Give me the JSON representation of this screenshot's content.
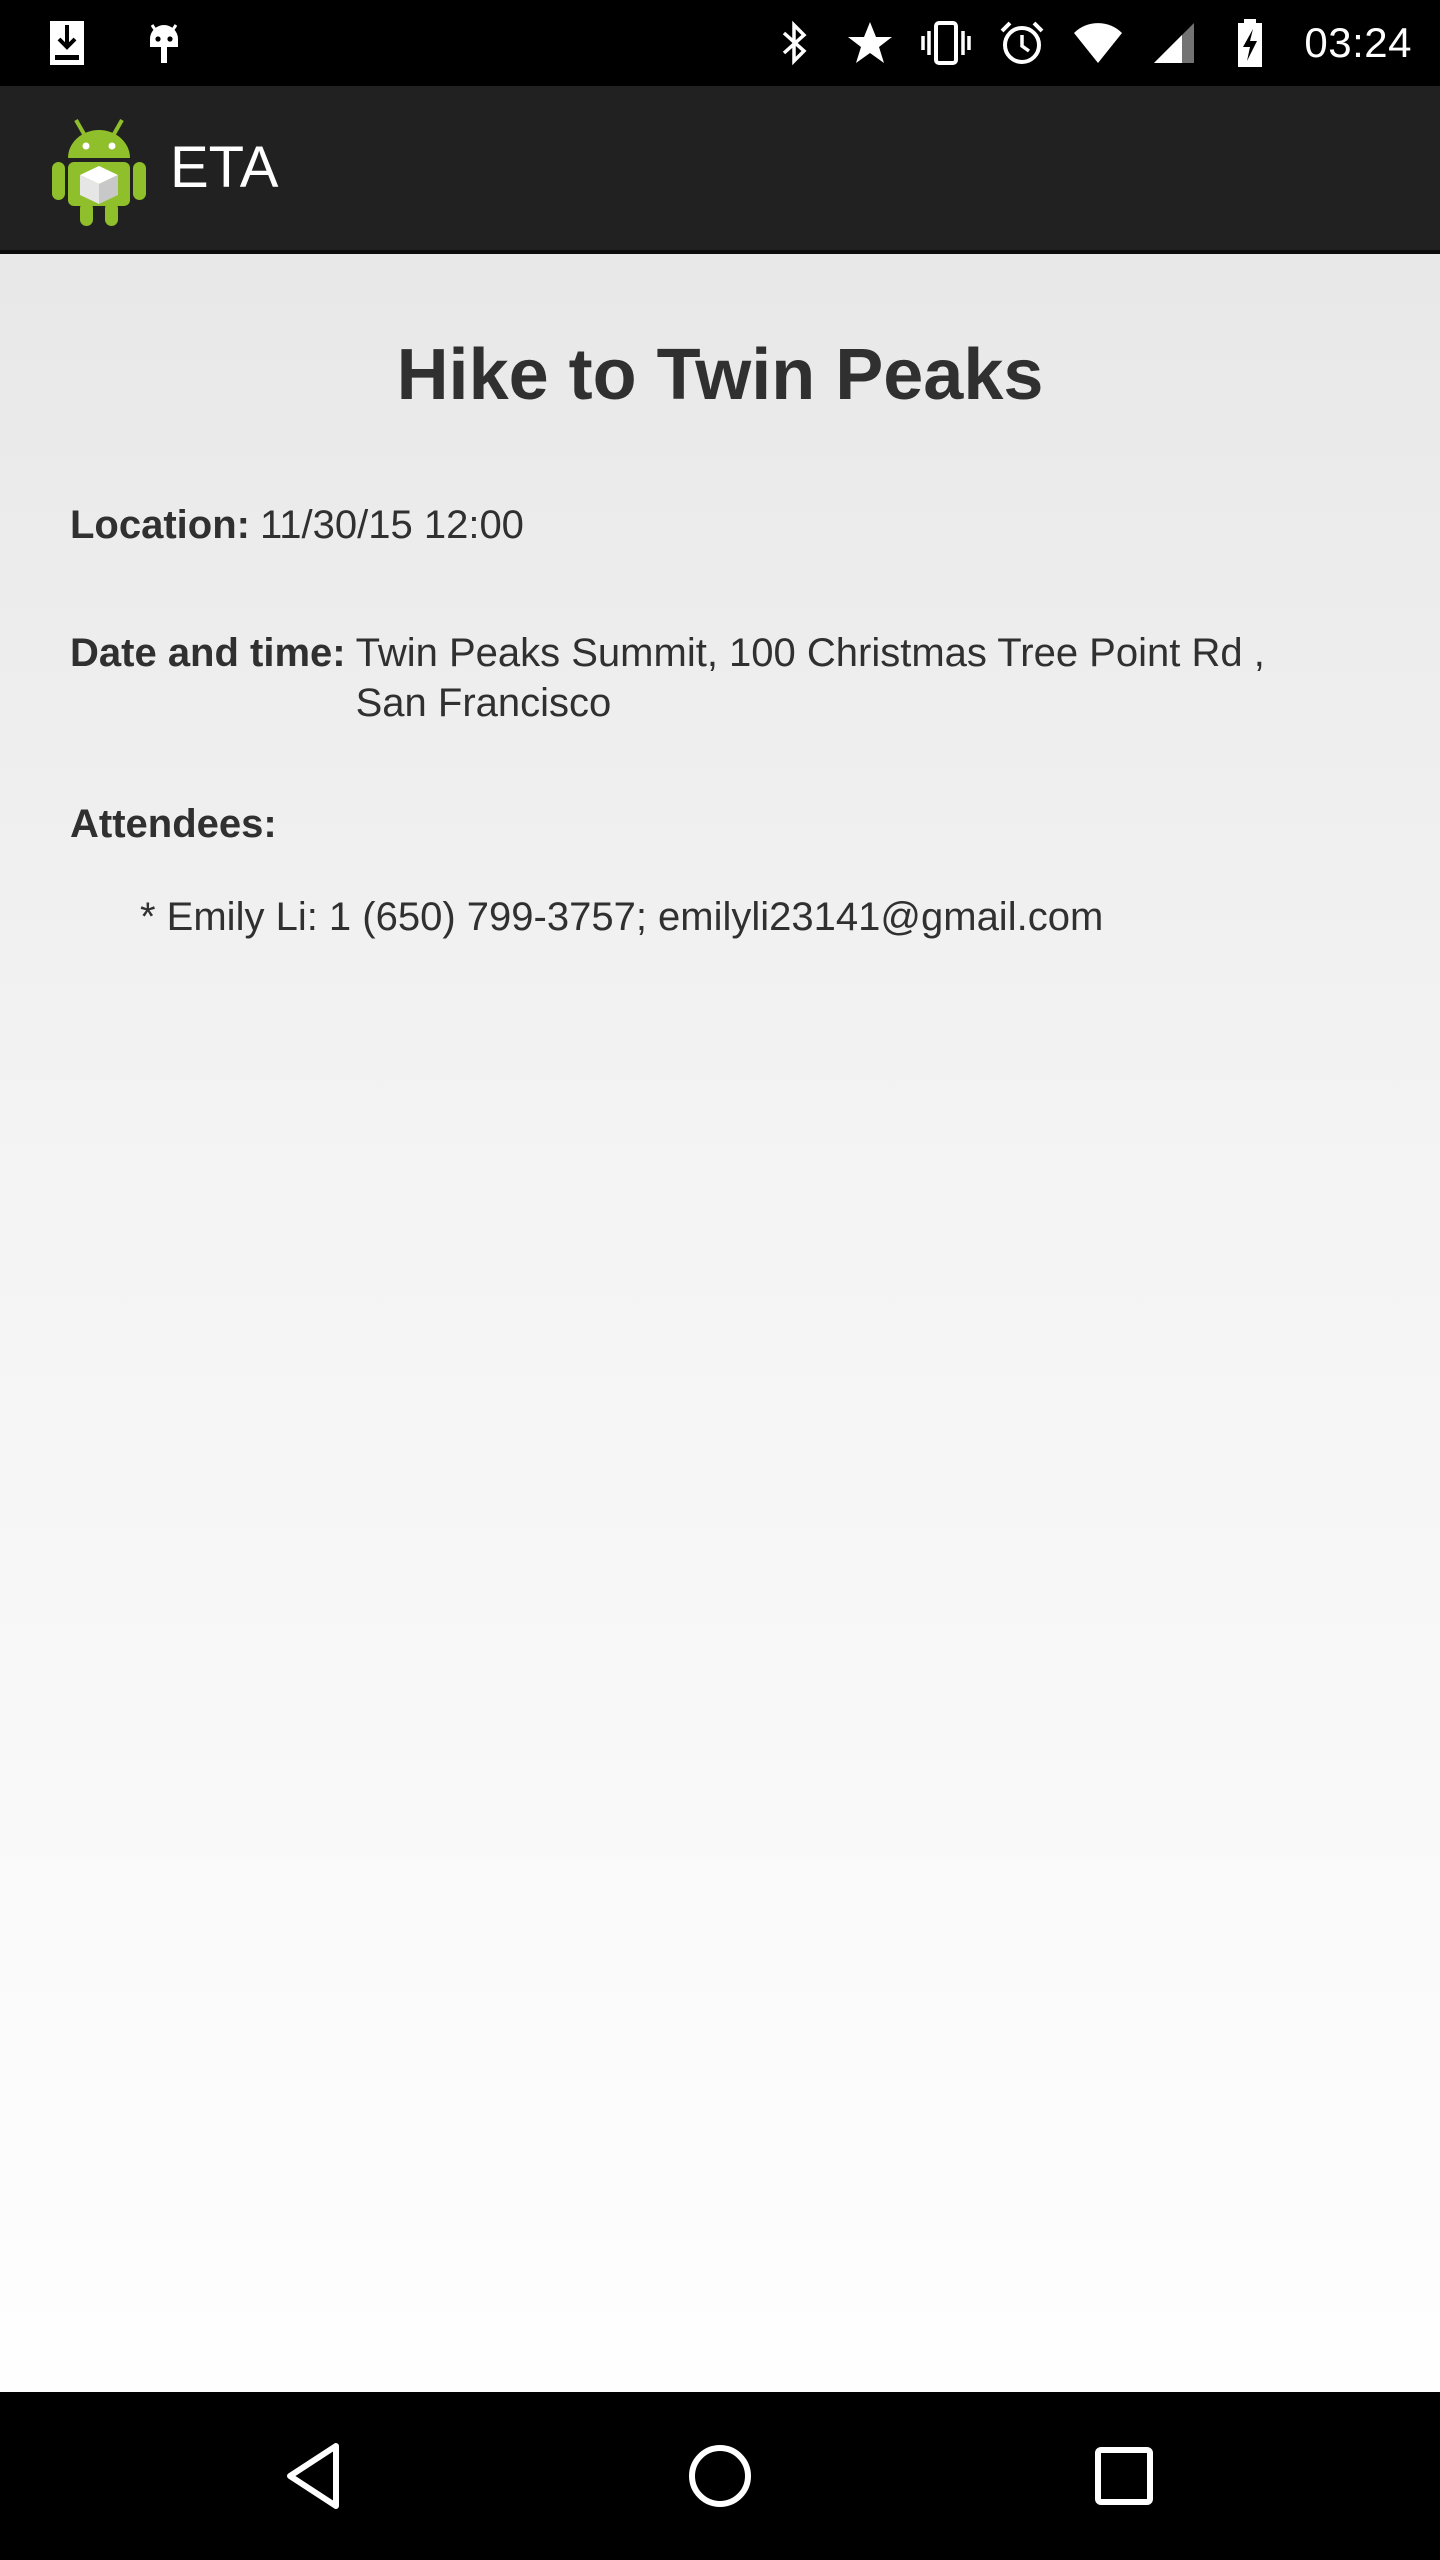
{
  "status_bar": {
    "left_icons": [
      "download-icon",
      "android-debug-icon"
    ],
    "right_icons": [
      "bluetooth-icon",
      "star-icon",
      "vibrate-icon",
      "alarm-icon",
      "wifi-icon",
      "cellular-signal-icon",
      "battery-charging-icon"
    ],
    "time": "03:24"
  },
  "action_bar": {
    "app_title": "ETA",
    "logo_icon": "android-app-icon"
  },
  "event": {
    "title": "Hike to Twin Peaks",
    "location_label": "Location:",
    "location_value": "11/30/15 12:00",
    "datetime_label": "Date and time:",
    "datetime_value": "Twin Peaks Summit, 100 Christmas Tree Point Rd , San Francisco",
    "attendees_label": "Attendees:",
    "attendees": [
      "* Emily Li: 1 (650) 799-3757; emilyli23141@gmail.com"
    ]
  },
  "nav_bar": {
    "buttons": [
      "back-icon",
      "home-icon",
      "recents-icon"
    ]
  },
  "colors": {
    "status_bar_bg": "#000000",
    "action_bar_bg": "#212121",
    "text_primary": "#303030",
    "android_green": "#8fbf2a"
  }
}
